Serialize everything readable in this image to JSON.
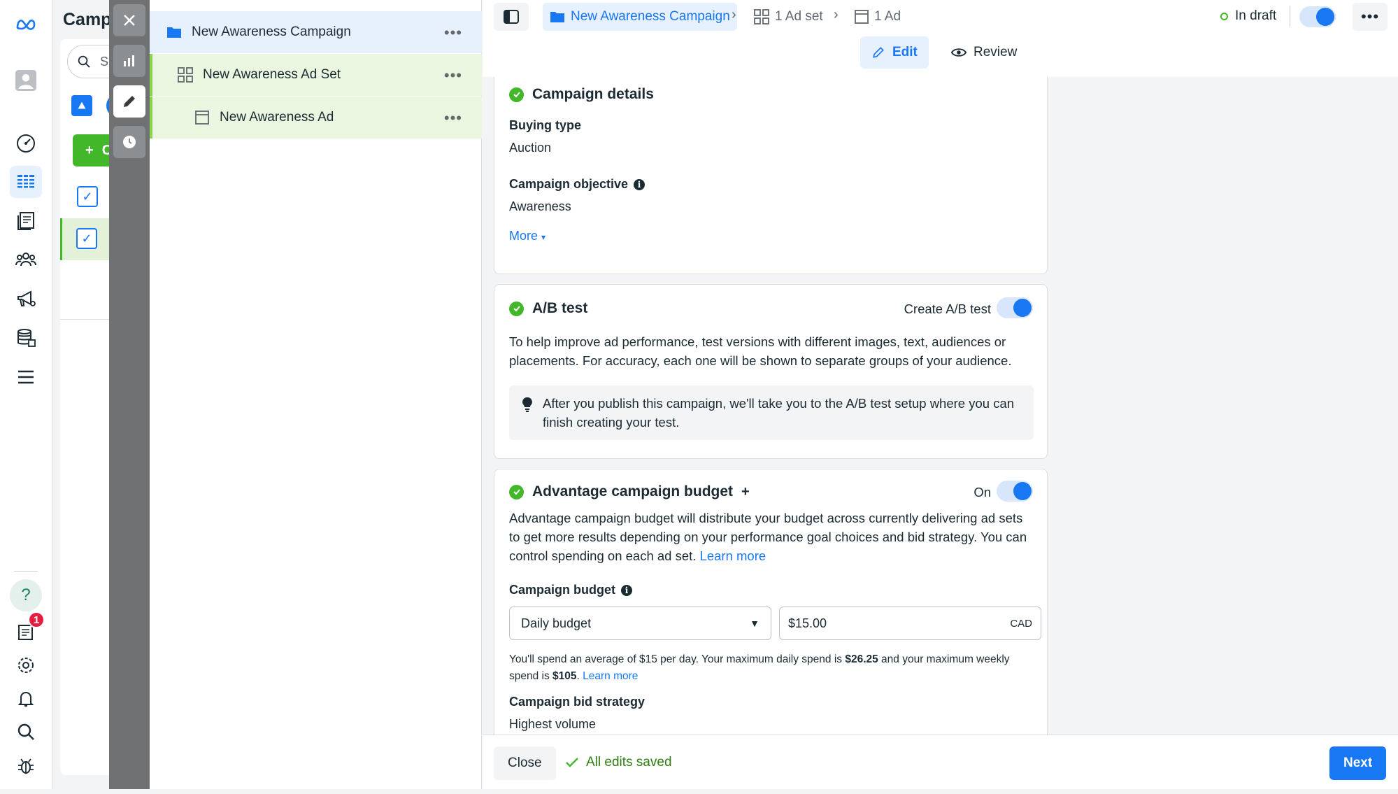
{
  "underlying": {
    "title": "Campa",
    "search_placeholder": "S",
    "create_button": "C"
  },
  "tree": {
    "campaign": "New Awareness Campaign",
    "ad_set": "New Awareness Ad Set",
    "ad": "New Awareness Ad"
  },
  "header": {
    "crumb_campaign": "New Awareness Campaign",
    "crumb_adset": "1 Ad set",
    "crumb_ad": "1 Ad",
    "status": "In draft",
    "tab_edit": "Edit",
    "tab_review": "Review"
  },
  "campaign_details": {
    "title": "Campaign details",
    "buying_type_label": "Buying type",
    "buying_type_value": "Auction",
    "objective_label": "Campaign objective",
    "objective_value": "Awareness",
    "more": "More"
  },
  "ab_test": {
    "title": "A/B test",
    "toggle_label": "Create A/B test",
    "description": "To help improve ad performance, test versions with different images, text, audiences or placements. For accuracy, each one will be shown to separate groups of your audience.",
    "tip": "After you publish this campaign, we'll take you to the A/B test setup where you can finish creating your test."
  },
  "budget": {
    "title": "Advantage campaign budget",
    "title_suffix": "+",
    "toggle_label": "On",
    "description": "Advantage campaign budget will distribute your budget across currently delivering ad sets to get more results depending on your performance goal choices and bid strategy. You can control spending on each ad set.",
    "learn_more": "Learn more",
    "budget_label": "Campaign budget",
    "budget_type": "Daily budget",
    "amount": "$15.00",
    "currency": "CAD",
    "note_1": "You'll spend an average of $15 per day. Your maximum daily spend is ",
    "note_max_daily": "$26.25",
    "note_2": " and your maximum weekly spend is ",
    "note_max_weekly": "$105",
    "note_3": ". ",
    "note_learn": "Learn more",
    "bid_label": "Campaign bid strategy",
    "bid_value": "Highest volume"
  },
  "footer": {
    "close": "Close",
    "saved": "All edits saved",
    "next": "Next"
  },
  "nav": {
    "notification_count": "1"
  },
  "colors": {
    "accent": "#1877f2",
    "success": "#42b72a"
  }
}
